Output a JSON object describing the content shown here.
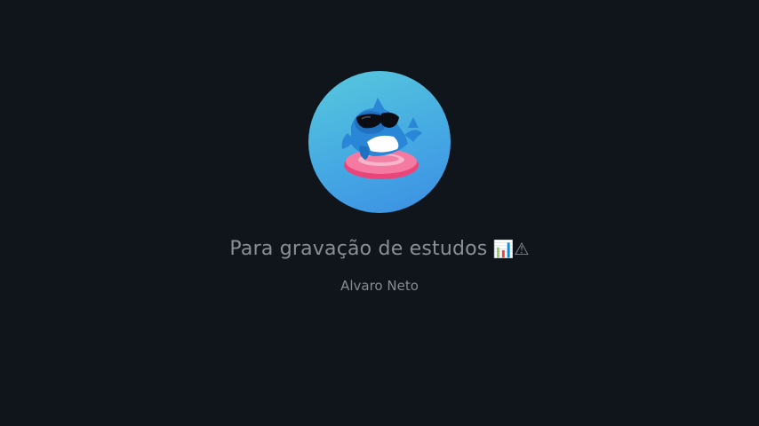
{
  "profile": {
    "title": "Para gravação de estudos",
    "title_icons": "📊⚠",
    "subtitle": "Alvaro Neto"
  }
}
